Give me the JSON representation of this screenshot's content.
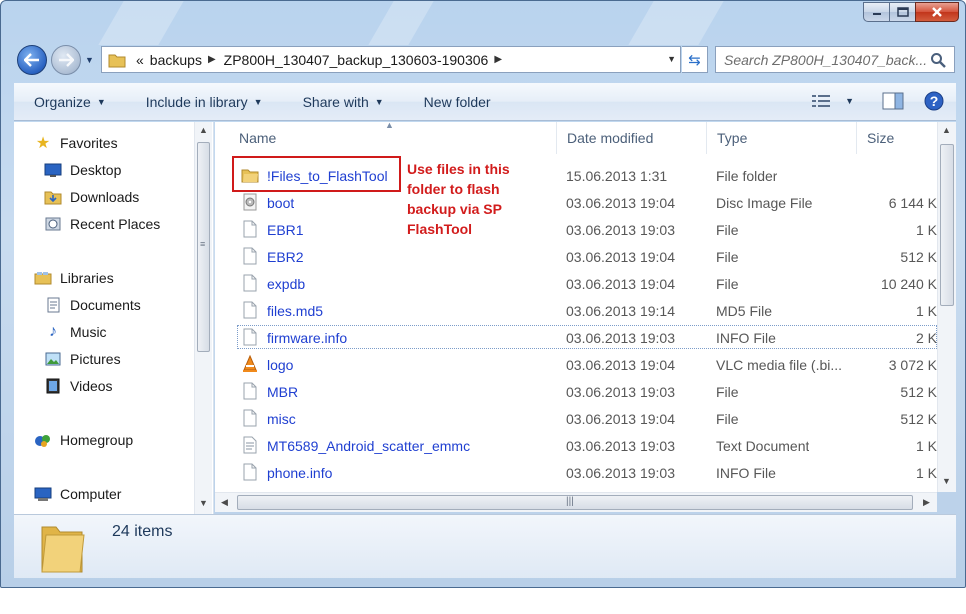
{
  "window": {
    "caption_buttons": [
      "minimize-icon",
      "maximize-icon",
      "close-icon"
    ]
  },
  "address_bar": {
    "overflow_marker": "«",
    "crumbs": [
      "backups",
      "ZP800H_130407_backup_130603-190306"
    ]
  },
  "search": {
    "placeholder": "Search ZP800H_130407_back..."
  },
  "toolbar": {
    "organize": "Organize",
    "include_in_library": "Include in library",
    "share_with": "Share with",
    "new_folder": "New folder"
  },
  "nav": {
    "favorites": {
      "label": "Favorites",
      "items": [
        "Desktop",
        "Downloads",
        "Recent Places"
      ]
    },
    "libraries": {
      "label": "Libraries",
      "items": [
        "Documents",
        "Music",
        "Pictures",
        "Videos"
      ]
    },
    "homegroup": "Homegroup",
    "computer": "Computer"
  },
  "columns": {
    "name": "Name",
    "date": "Date modified",
    "type": "Type",
    "size": "Size"
  },
  "files": [
    {
      "name": "!Files_to_FlashTool",
      "date": "15.06.2013 1:31",
      "type": "File folder",
      "size": "",
      "icon": "folder-icon"
    },
    {
      "name": "boot",
      "date": "03.06.2013 19:04",
      "type": "Disc Image File",
      "size": "6 144 K",
      "icon": "disc-image-icon"
    },
    {
      "name": "EBR1",
      "date": "03.06.2013 19:03",
      "type": "File",
      "size": "1 K",
      "icon": "file-icon"
    },
    {
      "name": "EBR2",
      "date": "03.06.2013 19:04",
      "type": "File",
      "size": "512 K",
      "icon": "file-icon"
    },
    {
      "name": "expdb",
      "date": "03.06.2013 19:04",
      "type": "File",
      "size": "10 240 K",
      "icon": "file-icon"
    },
    {
      "name": "files.md5",
      "date": "03.06.2013 19:14",
      "type": "MD5 File",
      "size": "1 K",
      "icon": "file-icon"
    },
    {
      "name": "firmware.info",
      "date": "03.06.2013 19:03",
      "type": "INFO File",
      "size": "2 K",
      "icon": "file-icon"
    },
    {
      "name": "logo",
      "date": "03.06.2013 19:04",
      "type": "VLC media file (.bi...",
      "size": "3 072 K",
      "icon": "vlc-icon"
    },
    {
      "name": "MBR",
      "date": "03.06.2013 19:03",
      "type": "File",
      "size": "512 K",
      "icon": "file-icon"
    },
    {
      "name": "misc",
      "date": "03.06.2013 19:04",
      "type": "File",
      "size": "512 K",
      "icon": "file-icon"
    },
    {
      "name": "MT6589_Android_scatter_emmc",
      "date": "03.06.2013 19:03",
      "type": "Text Document",
      "size": "1 K",
      "icon": "text-document-icon"
    },
    {
      "name": "phone.info",
      "date": "03.06.2013 19:03",
      "type": "INFO File",
      "size": "1 K",
      "icon": "file-icon"
    }
  ],
  "annotation": {
    "text": "Use files in this folder to flash backup via SP FlashTool",
    "color": "#d01a1a"
  },
  "details": {
    "count": "24 items"
  }
}
